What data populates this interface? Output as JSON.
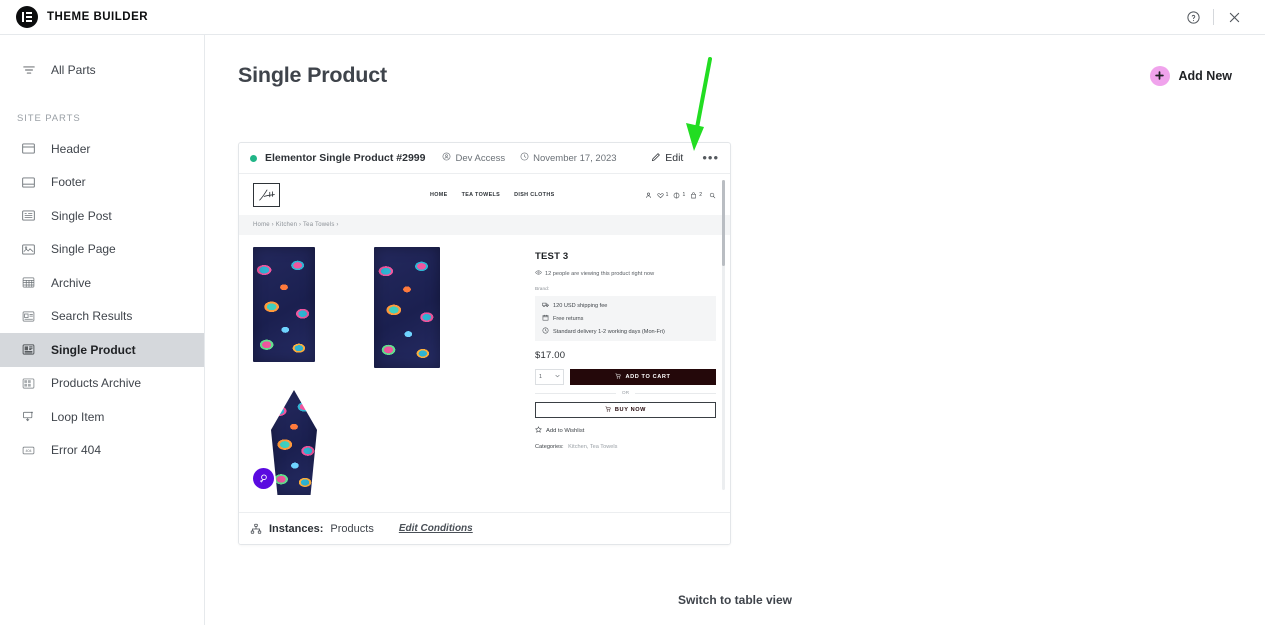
{
  "topbar": {
    "brand_name": "THEME BUILDER",
    "brand_logo_icon": "elementor-e-icon",
    "help_icon": "help-circle-icon",
    "close_icon": "close-x-icon"
  },
  "sidebar": {
    "all_parts": {
      "label": "All Parts",
      "icon": "filter-lines-icon"
    },
    "section_title": "SITE PARTS",
    "items": [
      {
        "label": "Header",
        "icon": "header-layout-icon",
        "active": false
      },
      {
        "label": "Footer",
        "icon": "footer-layout-icon",
        "active": false
      },
      {
        "label": "Single Post",
        "icon": "single-post-icon",
        "active": false
      },
      {
        "label": "Single Page",
        "icon": "single-page-icon",
        "active": false
      },
      {
        "label": "Archive",
        "icon": "archive-grid-icon",
        "active": false
      },
      {
        "label": "Search Results",
        "icon": "search-results-icon",
        "active": false
      },
      {
        "label": "Single Product",
        "icon": "single-product-icon",
        "active": true
      },
      {
        "label": "Products Archive",
        "icon": "products-archive-icon",
        "active": false
      },
      {
        "label": "Loop Item",
        "icon": "loop-item-icon",
        "active": false
      },
      {
        "label": "Error 404",
        "icon": "error-404-icon",
        "active": false
      }
    ]
  },
  "page": {
    "title": "Single Product",
    "add_new_label": "Add New",
    "add_new_icon": "plus-icon",
    "add_new_color": "#f0a3ec",
    "switch_view_label": "Switch to table view"
  },
  "card": {
    "status_color": "#21b587",
    "title": "Elementor Single Product #2999",
    "access_icon": "user-circle-icon",
    "access_label": "Dev Access",
    "date_icon": "clock-icon",
    "date_label": "November 17, 2023",
    "edit_icon": "pencil-icon",
    "edit_label": "Edit",
    "more_label": "•••",
    "footer": {
      "icon": "sitemap-icon",
      "label": "Instances:",
      "value": "Products",
      "link": "Edit Conditions"
    }
  },
  "preview": {
    "logo_icon": "handwritten-logo-icon",
    "nav": [
      "HOME",
      "TEA TOWELS",
      "DISH CLOTHS"
    ],
    "header_icons": [
      {
        "icon": "account-icon",
        "count": ""
      },
      {
        "icon": "heart-wishlist-icon",
        "count": "1"
      },
      {
        "icon": "compare-icon",
        "count": "1"
      },
      {
        "icon": "cart-bag-icon",
        "count": "2"
      },
      {
        "icon": "search-icon",
        "count": ""
      }
    ],
    "breadcrumb": "Home  ›  Kitchen  ›  Tea Towels  ›",
    "zoom_badge_icon": "magnifier-icon",
    "zoom_badge_color": "#5a0ae0",
    "product": {
      "title": "TEST 3",
      "viewing_icon": "eye-icon",
      "viewing_text": "12 people are viewing this product right now",
      "brand_label": "Brand:",
      "info_rows": [
        {
          "icon": "shipping-icon",
          "text": "120 USD shipping fee"
        },
        {
          "icon": "returns-calendar-icon",
          "text": "Free returns"
        },
        {
          "icon": "clock-delivery-icon",
          "text": "Standard delivery 1-2 working days (Mon-Fri)"
        }
      ],
      "price": "$17.00",
      "qty_value": "1",
      "qty_caret": "⌄",
      "add_to_cart_label": "ADD TO CART",
      "add_to_cart_icon": "cart-icon",
      "or_label": "OR",
      "buy_now_label": "BUY NOW",
      "buy_now_icon": "cart-icon",
      "wishlist_icon": "star-outline-icon",
      "wishlist_label": "Add to Wishlist",
      "categories_label": "Categories:",
      "categories_value": "Kitchen, Tea Towels"
    }
  },
  "annotation": {
    "arrow_color": "#22dd22",
    "target": "edit-button"
  }
}
